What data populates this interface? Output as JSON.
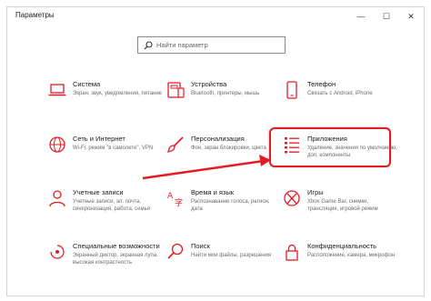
{
  "window": {
    "title": "Параметры"
  },
  "controls": {
    "minimize": "—",
    "maximize": "☐",
    "close": "✕"
  },
  "search": {
    "placeholder": "Найти параметр"
  },
  "accent": "#e31b23",
  "items": [
    {
      "icon": "laptop-icon",
      "title": "Система",
      "desc": "Экран, звук, уведомления, питание"
    },
    {
      "icon": "devices-icon",
      "title": "Устройства",
      "desc": "Bluetooth, принтеры, мышь"
    },
    {
      "icon": "phone-icon",
      "title": "Телефон",
      "desc": "Связать с Android, iPhone"
    },
    {
      "icon": "globe-icon",
      "title": "Сеть и Интернет",
      "desc": "Wi-Fi, режим \"в самолете\", VPN"
    },
    {
      "icon": "paintbrush-icon",
      "title": "Персонализация",
      "desc": "Фон, экран блокировки, цвета"
    },
    {
      "icon": "apps-list-icon",
      "title": "Приложения",
      "desc": "Удаление, значения по умолчанию, доп. компоненты"
    },
    {
      "icon": "person-icon",
      "title": "Учетные записи",
      "desc": "Учетные записи, эл. почта, синхронизация, работа, семья"
    },
    {
      "icon": "time-language-icon",
      "title": "Время и язык",
      "desc": "Распознавание голоса, регион, дата"
    },
    {
      "icon": "xbox-icon",
      "title": "Игры",
      "desc": "Xbox Game Bar, снимки, трансляция, игровой режим"
    },
    {
      "icon": "accessibility-icon",
      "title": "Специальные возможности",
      "desc": "Экранный диктор, экранная лупа, высокая контрастность"
    },
    {
      "icon": "search-icon",
      "title": "Поиск",
      "desc": "Найти мои файлы, разрешения"
    },
    {
      "icon": "lock-icon",
      "title": "Конфиденциальность",
      "desc": "Расположение, камера, микрофон"
    }
  ]
}
